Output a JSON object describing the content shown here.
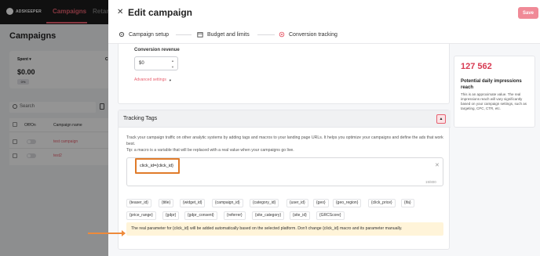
{
  "app": {
    "logo_text": "ADSKEEPER",
    "nav": [
      "Campaigns",
      "Retar"
    ],
    "page_title": "Campaigns",
    "stat": {
      "label": "Spent",
      "value": "$0.00",
      "badge": "0%",
      "next_label": "C"
    },
    "search_placeholder": "Search",
    "table_headers": [
      "Off/On",
      "Campaign name"
    ],
    "rows": [
      "test campaign",
      "test2"
    ]
  },
  "modal": {
    "title": "Edit campaign",
    "save_label": "Save",
    "steps": [
      "Campaign setup",
      "Budget and limits",
      "Conversion tracking"
    ],
    "conversion_revenue": {
      "label": "Conversion revenue",
      "value": "$0",
      "advanced_label": "Advanced settings"
    },
    "reach": {
      "value": "127 562",
      "label": "Potential daily impressions reach",
      "description": "This is an approximate value. The real impressions reach will vary significantly based on your campaign settings, such as targeting, CPC, CTR, etc."
    },
    "tracking_tags": {
      "title": "Tracking Tags",
      "description_1": "Track your campaign traffic on other analytic systems by adding tags and macros to your landing page URLs. It helps you optimize your campaigns and define the ads that work best.",
      "description_2": "Tip: a macro is a variable that will be replaced with a real value when your campaigns go live.",
      "input_value": "click_id={click_id}",
      "counter": "19/800",
      "macros": [
        "{teaser_id}",
        "{title}",
        "{widget_id}",
        "{campaign_id}",
        "{category_id}",
        "{user_id}",
        "{geo}",
        "{geo_region}",
        "{click_price}",
        "{ifa}",
        "{price_range}",
        "{gdpr}",
        "{gdpr_consent}",
        "{referrer}",
        "{site_category}",
        "{site_id}",
        "{GRCScore}"
      ],
      "note": "The real parameter for {click_id} will be added automatically based on the selected platform. Don't change {click_id} macro and its parameter manually."
    }
  },
  "colors": {
    "accent": "#e8606f",
    "highlight_border": "#e07b2a",
    "reach_value": "#d83a52",
    "note_bg": "#fff4d9"
  }
}
